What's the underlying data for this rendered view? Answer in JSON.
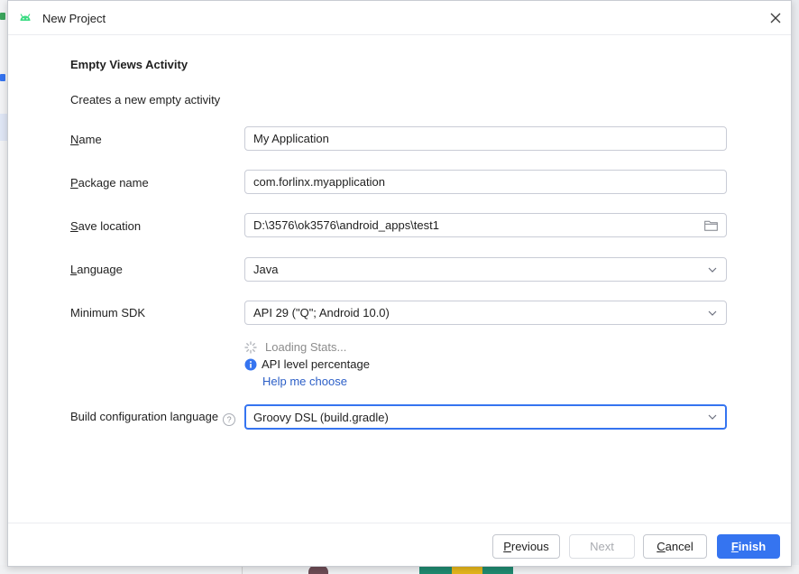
{
  "window": {
    "title": "New Project",
    "icon": "android-icon"
  },
  "content": {
    "heading": "Empty Views Activity",
    "description": "Creates a new empty activity"
  },
  "form": {
    "name": {
      "label_mnemonic": "N",
      "label_rest": "ame",
      "value": "My Application"
    },
    "package_name": {
      "label_mnemonic": "P",
      "label_rest": "ackage name",
      "value": "com.forlinx.myapplication"
    },
    "save_location": {
      "label_mnemonic": "S",
      "label_rest": "ave location",
      "value": "D:\\3576\\ok3576\\android_apps\\test1"
    },
    "language": {
      "label_mnemonic": "L",
      "label_rest": "anguage",
      "value": "Java"
    },
    "minimum_sdk": {
      "label": "Minimum SDK",
      "value": "API 29 (\"Q\"; Android 10.0)"
    },
    "build_config": {
      "label": "Build configuration language",
      "help_glyph": "?",
      "value": "Groovy DSL (build.gradle)"
    }
  },
  "sdk_info": {
    "loading": "Loading Stats...",
    "api_level": "API level percentage",
    "help_link": "Help me choose"
  },
  "footer": {
    "previous": {
      "mnemonic": "P",
      "rest": "revious"
    },
    "next": "Next",
    "cancel": {
      "mnemonic": "C",
      "rest": "ancel"
    },
    "finish": {
      "mnemonic": "F",
      "rest": "inish"
    }
  },
  "colors": {
    "accent": "#3574f0",
    "link": "#2c5fc7",
    "android_green": "#3ddc84",
    "muted_text": "#8c8c8c"
  }
}
